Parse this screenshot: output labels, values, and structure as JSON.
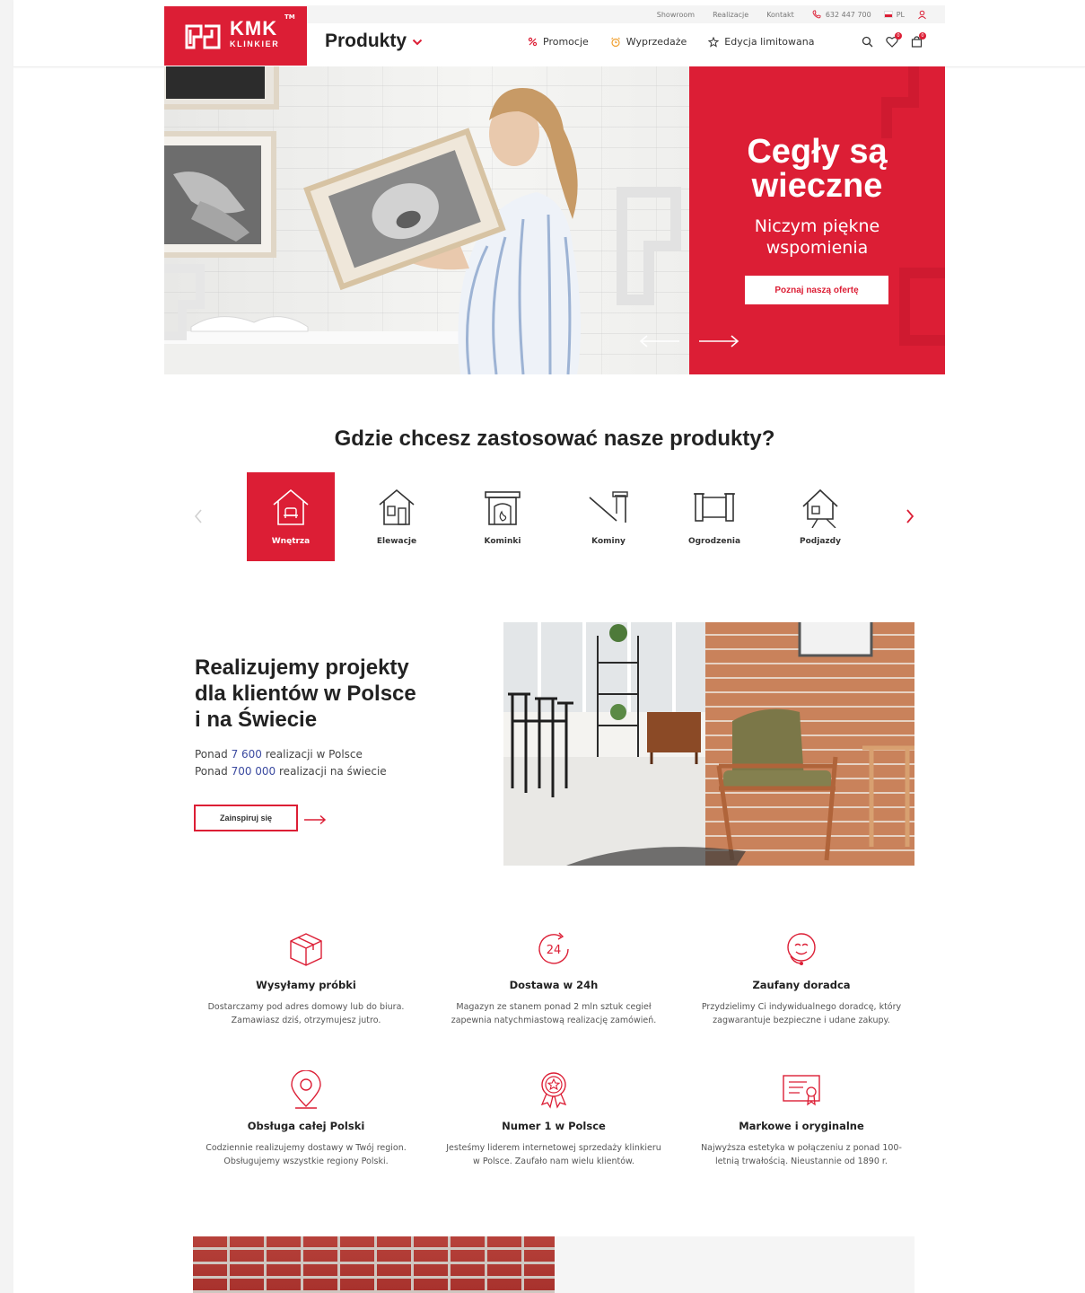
{
  "brand": {
    "name": "KMK",
    "sub": "KLINKIER",
    "tm": "TM",
    "accent": "#dc1e35"
  },
  "topbar": {
    "showroom": "Showroom",
    "realizacje": "Realizacje",
    "kontakt": "Kontakt",
    "phone": "632 447 700",
    "lang": "PL"
  },
  "nav": {
    "produkty": "Produkty",
    "promocje": "Promocje",
    "wyprzedaze": "Wyprzedaże",
    "edycja": "Edycja limitowana",
    "wishlist_count": "0",
    "cart_count": "0"
  },
  "hero": {
    "title_line1": "Cegły są",
    "title_line2": "wieczne",
    "sub_line1": "Niczym piękne",
    "sub_line2": "wspomienia",
    "button": "Poznaj naszą ofertę"
  },
  "categories": {
    "title": "Gdzie chcesz zastosować nasze produkty?",
    "items": [
      {
        "label": "Wnętrza"
      },
      {
        "label": "Elewacje"
      },
      {
        "label": "Kominki"
      },
      {
        "label": "Kominy"
      },
      {
        "label": "Ogrodzenia"
      },
      {
        "label": "Podjazdy"
      }
    ]
  },
  "realizations": {
    "title_line1": "Realizujemy projekty",
    "title_line2": "dla klientów w Polsce",
    "title_line3": "i na Świecie",
    "stat1_prefix": "Ponad",
    "stat1_num": "7 600",
    "stat1_suffix": "realizacji w Polsce",
    "stat2_prefix": "Ponad",
    "stat2_num": "700 000",
    "stat2_suffix": "realizacji na świecie",
    "button": "Zainspiruj się"
  },
  "features": [
    {
      "title": "Wysyłamy próbki",
      "desc": "Dostarczamy pod adres domowy lub do biura. Zamawiasz dziś, otrzymujesz jutro."
    },
    {
      "title": "Dostawa w 24h",
      "desc": "Magazyn ze stanem ponad 2 mln sztuk cegieł zapewnia natychmiastową realizację zamówień."
    },
    {
      "title": "Zaufany doradca",
      "desc": "Przydzielimy Ci indywidualnego doradcę, który zagwarantuje bezpieczne i udane zakupy."
    },
    {
      "title": "Obsługa całej Polski",
      "desc": "Codziennie realizujemy dostawy w Twój region. Obsługujemy wszystkie regiony Polski."
    },
    {
      "title": "Numer 1 w Polsce",
      "desc": "Jesteśmy liderem internetowej sprzedaży klinkieru w Polsce. Zaufało nam wielu klientów."
    },
    {
      "title": "Markowe i oryginalne",
      "desc": "Najwyższa estetyka w połączeniu z ponad 100-letnią trwałością. Nieustannie od 1890 r."
    }
  ],
  "icons": {
    "delivery_badge": "24"
  }
}
